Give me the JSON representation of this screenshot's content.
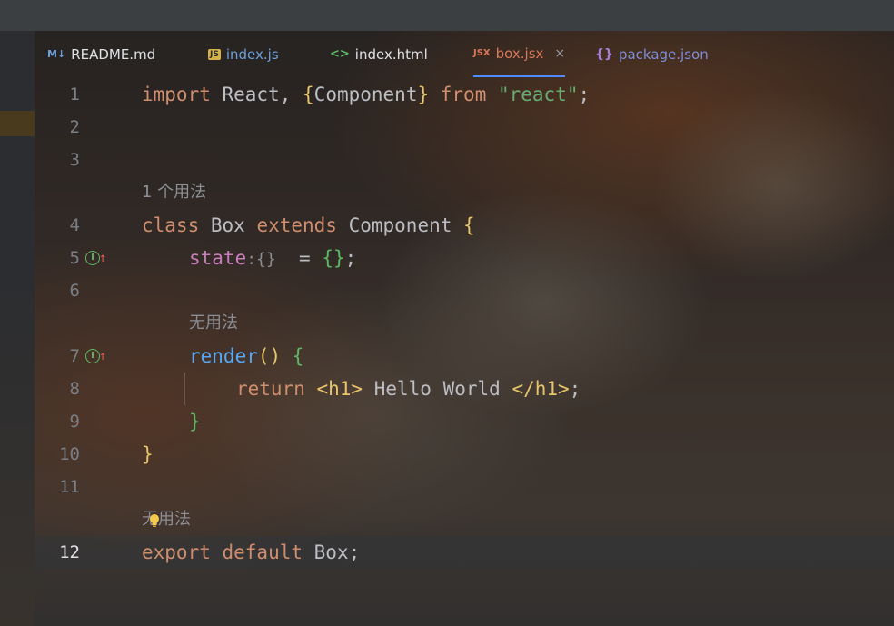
{
  "tabs": [
    {
      "icon": "M↓",
      "label": "README.md"
    },
    {
      "icon": "JS",
      "label": "index.js"
    },
    {
      "icon": "<>",
      "label": "index.html"
    },
    {
      "icon": "JSX",
      "label": "box.jsx",
      "close": "×"
    },
    {
      "icon": "{}",
      "label": "package.json"
    }
  ],
  "editor": {
    "line_numbers": [
      "1",
      "2",
      "3",
      "4",
      "5",
      "6",
      "7",
      "8",
      "9",
      "10",
      "11",
      "12"
    ],
    "hints": {
      "usage_1": "1 个用法",
      "no_usage_a": "无用法",
      "no_usage_b": "无用法"
    },
    "tokens": {
      "l1_import": "import",
      "l1_react": " React, ",
      "l1_lbrace": "{",
      "l1_component": "Component",
      "l1_rbrace": "}",
      "l1_from": " from ",
      "l1_str": "\"react\"",
      "l1_semi": ";",
      "l4_class": "class",
      "l4_box": " Box ",
      "l4_extends": "extends",
      "l4_component": " Component ",
      "l4_brace": "{",
      "l5_state": "state",
      "l5_type": ":{}",
      "l5_eq": "  = ",
      "l5_obj": "{}",
      "l5_semi": ";",
      "l7_render": "render",
      "l7_paren": "()",
      "l7_brace": " {",
      "l8_return": "return",
      "l8_open": " <h1>",
      "l8_text": " Hello World ",
      "l8_close": "</h1>",
      "l8_semi": ";",
      "l9_brace": "}",
      "l10_brace": "}",
      "l12_export": "export",
      "l12_default": " default",
      "l12_box": " Box;"
    }
  }
}
